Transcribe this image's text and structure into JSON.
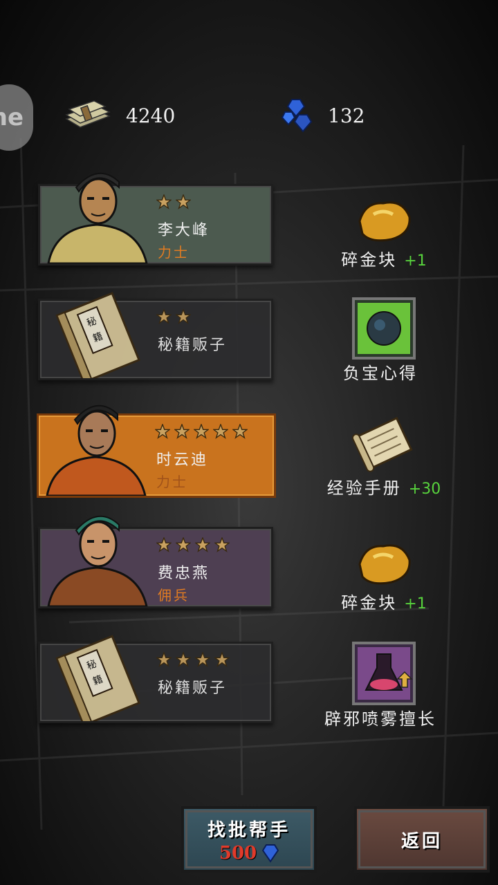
{
  "side_tab": {
    "label": "ne"
  },
  "currency": {
    "cash": "4240",
    "gems": "132"
  },
  "recruits": [
    {
      "stars": 2,
      "name": "李大峰",
      "role": "力士",
      "style": "green",
      "portrait": "male-cap-portrait"
    },
    {
      "stars": 2,
      "name": "秘籍贩子",
      "role": "",
      "style": "dark",
      "portrait": "secret-book-icon"
    },
    {
      "stars": 5,
      "name": "时云迪",
      "role": "力士",
      "style": "orange",
      "portrait": "male-masked-portrait"
    },
    {
      "stars": 4,
      "name": "费忠燕",
      "role": "佣兵",
      "style": "purple",
      "portrait": "female-green-hair-portrait"
    },
    {
      "stars": 4,
      "name": "秘籍贩子",
      "role": "",
      "style": "dark",
      "portrait": "secret-book-icon"
    }
  ],
  "book_label": "秘籍",
  "rewards": [
    {
      "name": "碎金块",
      "qty": "+1",
      "icon": "gold-nugget-icon"
    },
    {
      "name": "负宝心得",
      "qty": "",
      "icon": "green-skill-icon"
    },
    {
      "name": "经验手册",
      "qty": "+30",
      "icon": "scroll-icon"
    },
    {
      "name": "碎金块",
      "qty": "+1",
      "icon": "gold-nugget-icon"
    },
    {
      "name": "辟邪喷雾擅长",
      "qty": "",
      "icon": "purple-skill-icon"
    }
  ],
  "buttons": {
    "hire_label": "找批帮手",
    "hire_cost": "500",
    "back_label": "返回"
  },
  "colors": {
    "star": "#c9a160",
    "qty_green": "#58d33d",
    "role_orange": "#e07b22",
    "cost_red": "#e23a2a"
  }
}
